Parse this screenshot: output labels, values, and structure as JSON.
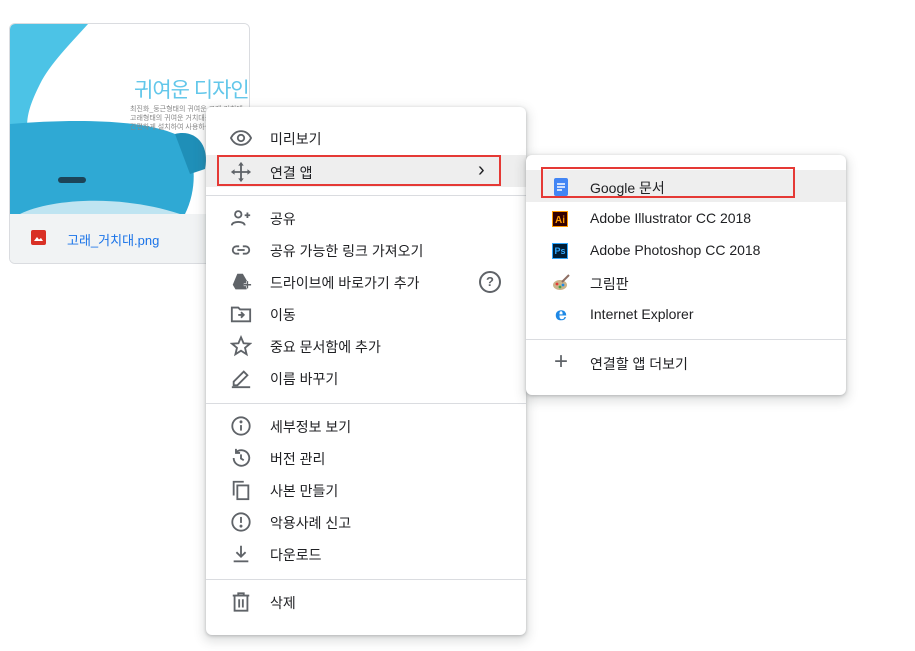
{
  "file": {
    "thumbnail_title": "귀여운 디자인",
    "thumbnail_lines": [
      "최진화_둥근형태의 귀여운 고래 거치대",
      "고래형태의 귀여운 거치대는 원",
      "간편하게 설치하여 사용하실수"
    ],
    "name": "고래_거치대.png"
  },
  "menu": {
    "items": [
      {
        "label": "미리보기",
        "icon": "eye-icon"
      },
      {
        "label": "연결 앱",
        "icon": "move-arrows-icon",
        "arrow": "›"
      },
      {
        "label": "공유",
        "icon": "add-person-icon"
      },
      {
        "label": "공유 가능한 링크 가져오기",
        "icon": "link-icon"
      },
      {
        "label": "드라이브에 바로가기 추가",
        "icon": "drive-shortcut-icon",
        "help": "?"
      },
      {
        "label": "이동",
        "icon": "move-folder-icon"
      },
      {
        "label": "중요 문서함에 추가",
        "icon": "star-icon"
      },
      {
        "label": "이름 바꾸기",
        "icon": "rename-pencil-icon"
      },
      {
        "label": "세부정보 보기",
        "icon": "info-icon"
      },
      {
        "label": "버전 관리",
        "icon": "history-icon"
      },
      {
        "label": "사본 만들기",
        "icon": "copy-icon"
      },
      {
        "label": "악용사례 신고",
        "icon": "report-icon"
      },
      {
        "label": "다운로드",
        "icon": "download-icon"
      },
      {
        "label": "삭제",
        "icon": "trash-icon"
      }
    ]
  },
  "submenu": {
    "items": [
      {
        "label": "Google 문서",
        "icon": "google-docs-icon",
        "icon_text": "",
        "color": "#4285f4"
      },
      {
        "label": "Adobe Illustrator CC 2018",
        "icon": "illustrator-icon",
        "icon_text": "Ai",
        "color": "#ff9a00"
      },
      {
        "label": "Adobe Photoshop CC 2018",
        "icon": "photoshop-icon",
        "icon_text": "Ps",
        "color": "#31a8ff"
      },
      {
        "label": "그림판",
        "icon": "paint-icon"
      },
      {
        "label": "Internet Explorer",
        "icon": "internet-explorer-icon",
        "icon_text": "e"
      },
      {
        "label": "연결할 앱 더보기",
        "icon": "plus-icon",
        "icon_text": "+"
      }
    ]
  },
  "colors": {
    "highlight_border": "#e53935",
    "accent": "#1a73e8",
    "hover": "#eeeeee"
  }
}
